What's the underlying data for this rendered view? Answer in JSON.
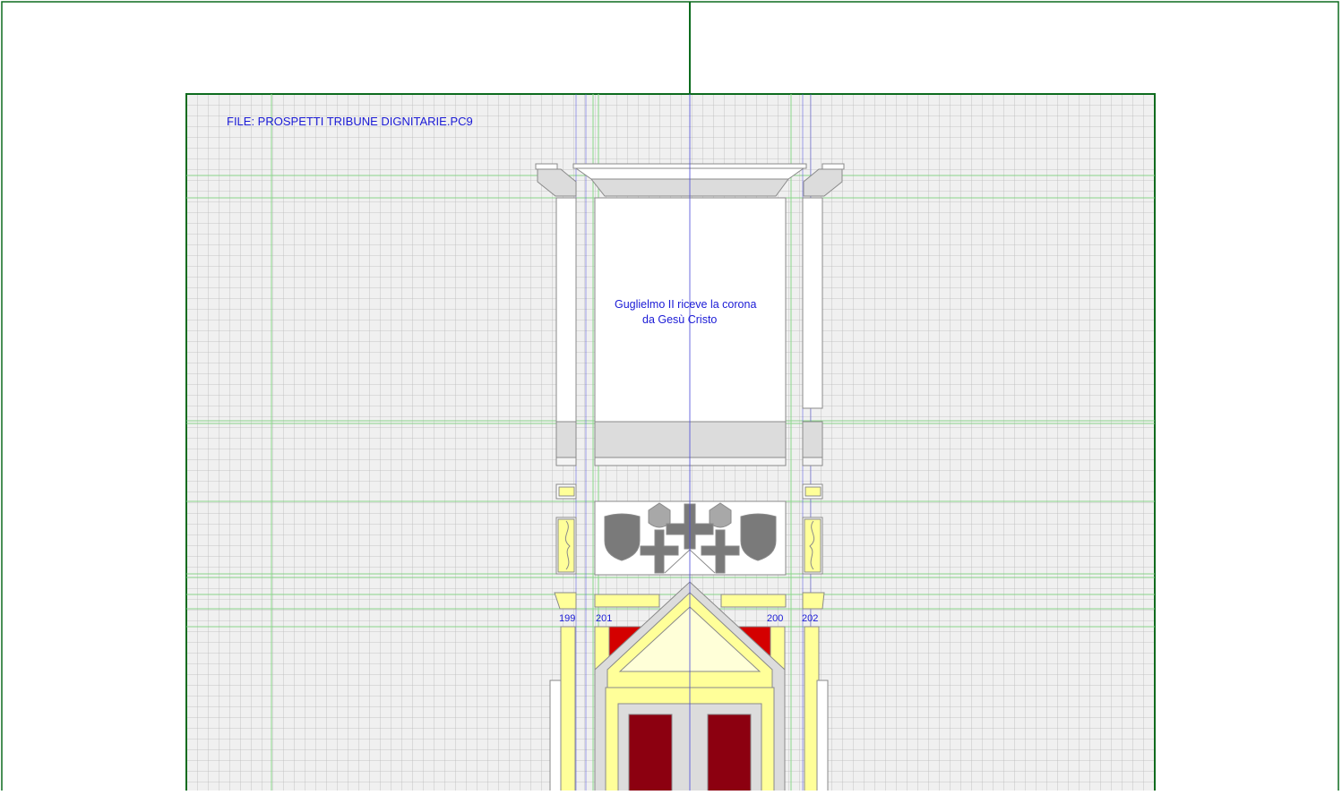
{
  "drawing": {
    "file_label": "FILE: PROSPETTI TRIBUNE DIGNITARIE.PC9",
    "caption_line1": "Guglielmo II riceve la corona",
    "caption_line2": "da Gesù Cristo",
    "element_numbers": [
      "199",
      "201",
      "200",
      "202"
    ]
  },
  "colors": {
    "frame_green": "#0d6b1e",
    "grid": "#b4b4b4",
    "guide_green": "#7fd07f",
    "guide_blue": "#4a4ad8",
    "label_blue": "#1a1ad6",
    "yellow_fill": "#ffff99",
    "cream_fill": "#ffffd8",
    "red_fill": "#d40000",
    "dark_red_fill": "#8c0010",
    "grey_fill": "#7a7a7a",
    "light_grey_fill": "#dcdcdc",
    "sheet_fill": "#f0f0f0"
  },
  "icons": [
    "shield-icon",
    "cross-icon"
  ]
}
